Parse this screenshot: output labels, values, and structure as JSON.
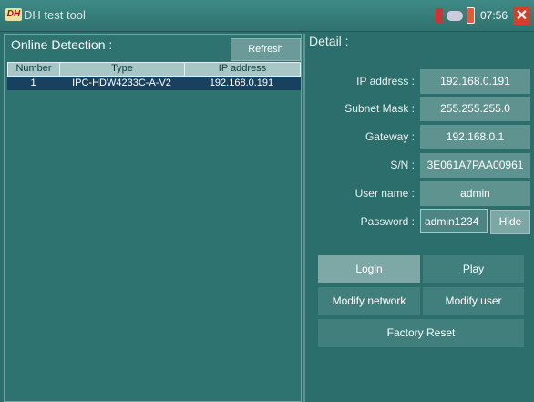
{
  "app": {
    "logo": "DH",
    "title": "DH test tool"
  },
  "status": {
    "time": "07:56",
    "icons": [
      "sd-card-icon",
      "usb-icon",
      "battery-icon"
    ],
    "close_icon": "close-icon"
  },
  "online_detection": {
    "title": "Online Detection :",
    "refresh_label": "Refresh",
    "columns": [
      "Number",
      "Type",
      "IP address"
    ],
    "rows": [
      {
        "number": "1",
        "type": "IPC-HDW4233C-A-V2",
        "ip": "192.168.0.191"
      }
    ]
  },
  "detail": {
    "title": "Detail :",
    "fields": [
      {
        "label": "IP address :",
        "value": "192.168.0.191"
      },
      {
        "label": "Subnet Mask :",
        "value": "255.255.255.0"
      },
      {
        "label": "Gateway :",
        "value": "192.168.0.1"
      },
      {
        "label": "S/N :",
        "value": "3E061A7PAA00961"
      },
      {
        "label": "User name :",
        "value": "admin"
      },
      {
        "label": "Password :",
        "value": "admin1234"
      }
    ],
    "hide_label": "Hide"
  },
  "actions": {
    "login": "Login",
    "play": "Play",
    "modify_network": "Modify network",
    "modify_user": "Modify user",
    "factory_reset": "Factory Reset"
  },
  "colors": {
    "background": "#2c6e6b",
    "selected_row": "#17415f",
    "close": "#d63e2a",
    "active_button": "#7ea8a6"
  }
}
